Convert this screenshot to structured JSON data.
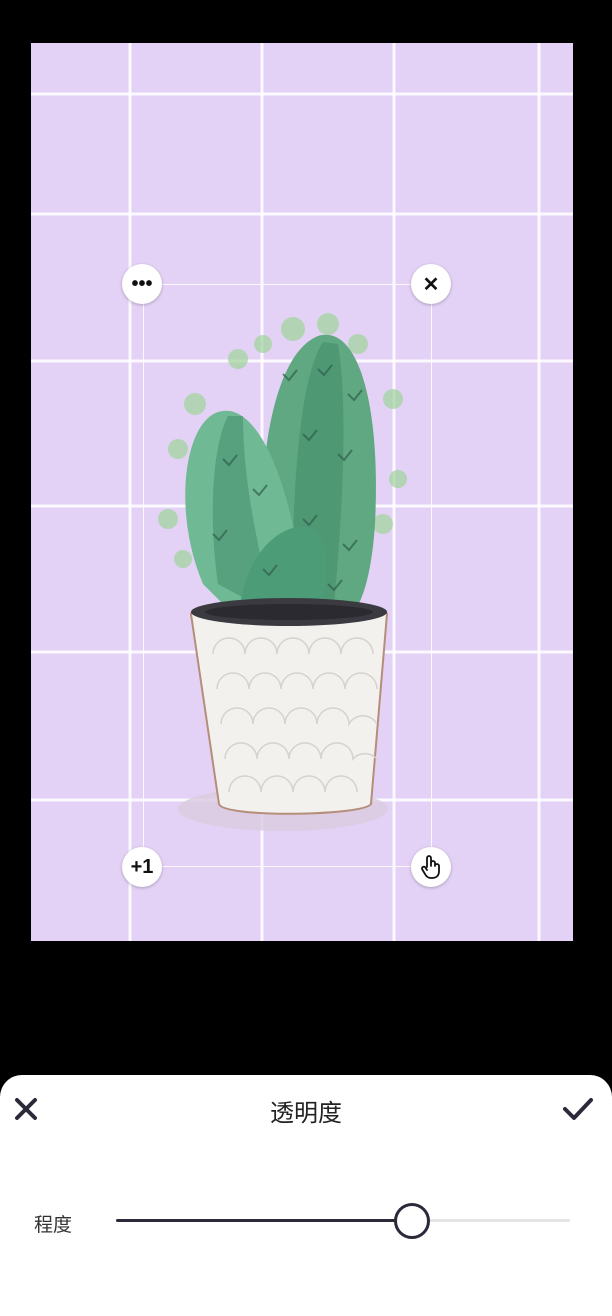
{
  "editor": {
    "canvas": {
      "background": "#e3d2f5",
      "grid_color": "#ffffff"
    },
    "sticker": {
      "icon": "cactus-pot",
      "handles": {
        "top_left": {
          "icon": "more-icon",
          "label": "•••"
        },
        "top_right": {
          "icon": "close-icon",
          "label": "✕"
        },
        "bottom_left": {
          "icon": "duplicate-icon",
          "label": "+1"
        },
        "bottom_right": {
          "icon": "hand-icon"
        }
      }
    }
  },
  "panel": {
    "title": "透明度",
    "cancel_icon": "close-icon",
    "confirm_icon": "check-icon",
    "slider": {
      "label": "程度",
      "value_fraction": 0.65
    }
  },
  "colors": {
    "sheet_bg": "#ffffff",
    "accent": "#2a2a3a",
    "page_bg": "#000000"
  }
}
